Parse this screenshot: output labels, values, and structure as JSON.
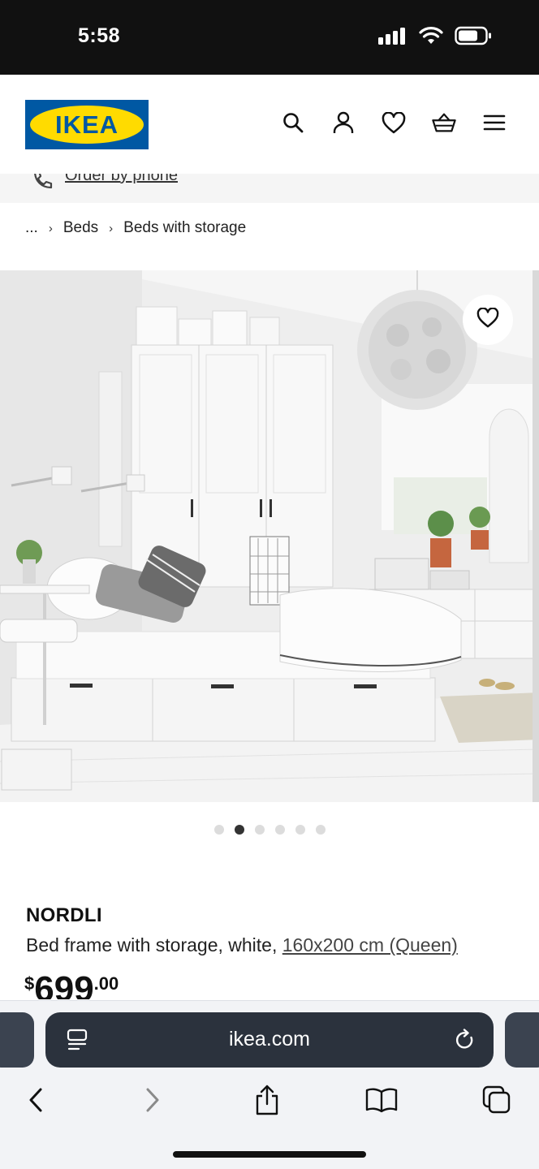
{
  "status_bar": {
    "time": "5:58"
  },
  "header": {
    "logo_text": "IKEA",
    "icons": [
      "search-icon",
      "account-icon",
      "heart-icon",
      "basket-icon",
      "menu-icon"
    ]
  },
  "phone_strip": {
    "link": "Order by phone"
  },
  "breadcrumb": {
    "ellipsis": "...",
    "items": [
      "Beds",
      "Beds with storage"
    ]
  },
  "gallery": {
    "total_images": 6,
    "active_index": 1
  },
  "product": {
    "name": "NORDLI",
    "description_prefix": "Bed frame with storage, white, ",
    "size_link": "160x200 cm (Queen)",
    "price_currency": "$",
    "price_integer": "699",
    "price_decimal": ".00"
  },
  "browser": {
    "url": "ikea.com"
  },
  "colors": {
    "ikea_blue": "#0058a3",
    "ikea_yellow": "#ffdb00"
  }
}
